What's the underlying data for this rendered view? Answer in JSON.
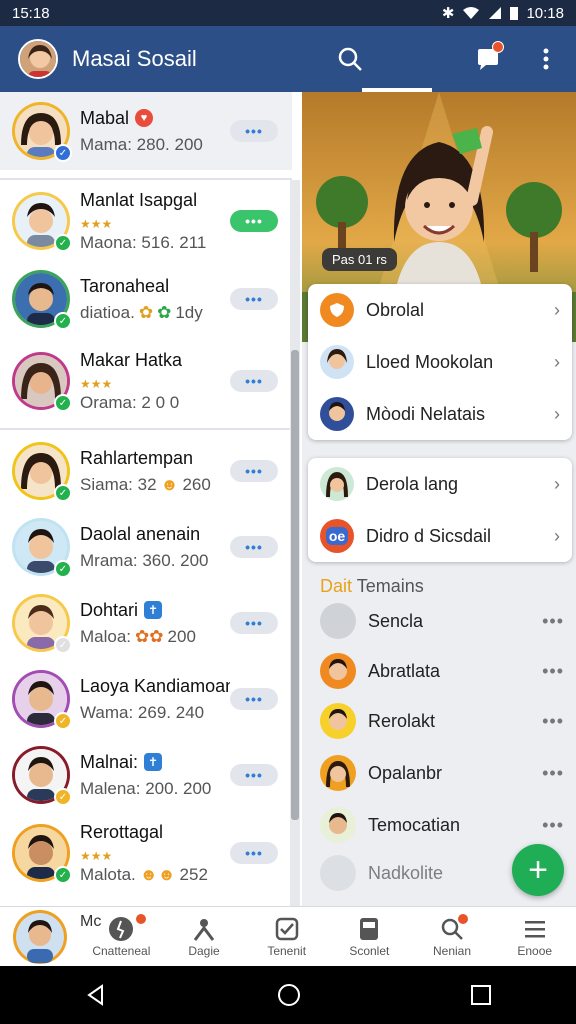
{
  "status": {
    "time_left": "15:18",
    "time_right": "10:18"
  },
  "header": {
    "title": "Masai Sosail",
    "search_icon": "search-icon",
    "chat_icon": "chat-bubble-icon",
    "menu_icon": "more-vert-icon"
  },
  "chats": [
    {
      "name": "Mabal",
      "sub": "Mama: 280. 200",
      "more": "•••"
    },
    {
      "name": "Manlat Isapgal",
      "stars": "★★★",
      "sub": "Maona: 516. 211",
      "more": "•••"
    },
    {
      "name": "Taronaheal",
      "sub": "diatioa.",
      "extra": "1dy",
      "more": "•••"
    },
    {
      "name": "Makar Hatka",
      "stars": "★★★",
      "sub": "Orama: 2 0 0",
      "more": "•••"
    },
    {
      "name": "Rahlartempan",
      "sub": "Siama: 32",
      "extra": "260",
      "more": "•••"
    },
    {
      "name": "Daolal anenain",
      "sub": "Mrama: 360. 200",
      "more": "•••"
    },
    {
      "name": "Dohtari",
      "sub": "Maloa:",
      "extra": "200",
      "more": "•••"
    },
    {
      "name": "Laoya Kandiamoan",
      "sub": "Wama: 269. 240",
      "more": "•••"
    },
    {
      "name": "Malnai:",
      "sub": "Malena: 200. 200",
      "more": "•••"
    },
    {
      "name": "Rerottagal",
      "stars": "★★★",
      "sub": "Malota.",
      "extra": "252",
      "more": "•••"
    }
  ],
  "hero": {
    "label": "Pas 01 rs"
  },
  "menu1": [
    {
      "label": "Obrolal",
      "chev": "›"
    },
    {
      "label": "Lloed Mookolan",
      "chev": "›"
    },
    {
      "label": "Mòodi Nelatais",
      "chev": "›"
    }
  ],
  "menu2": [
    {
      "label": "Derola lang",
      "chev": "›"
    },
    {
      "label": "Didro d Sicsdail",
      "chev": "›"
    }
  ],
  "section": {
    "accent": "Dait",
    "title": "Temains"
  },
  "contacts": [
    {
      "label": "Sencla",
      "dots": "•••"
    },
    {
      "label": "Abratlata",
      "dots": "•••"
    },
    {
      "label": "Rerolakt",
      "dots": "•••"
    },
    {
      "label": "Opalanbr",
      "dots": "•••"
    },
    {
      "label": "Temocatian",
      "dots": "•••"
    },
    {
      "label": "Nadkolite",
      "dots": ""
    }
  ],
  "fab": "+",
  "bottomnav": {
    "me": "Mc",
    "items": [
      {
        "label": "Cnatteneal",
        "icon": "runner-icon"
      },
      {
        "label": "Dagie",
        "icon": "person-icon"
      },
      {
        "label": "Tenenit",
        "icon": "check-icon"
      },
      {
        "label": "Sconlet",
        "icon": "tablet-icon"
      },
      {
        "label": "Nenian",
        "icon": "search-icon"
      },
      {
        "label": "Enooe",
        "icon": "menu-icon"
      }
    ]
  },
  "colors": {
    "header": "#2b4f86",
    "statusbar": "#1c2a44",
    "fab": "#1fae56",
    "accent": "#e8a21b"
  }
}
